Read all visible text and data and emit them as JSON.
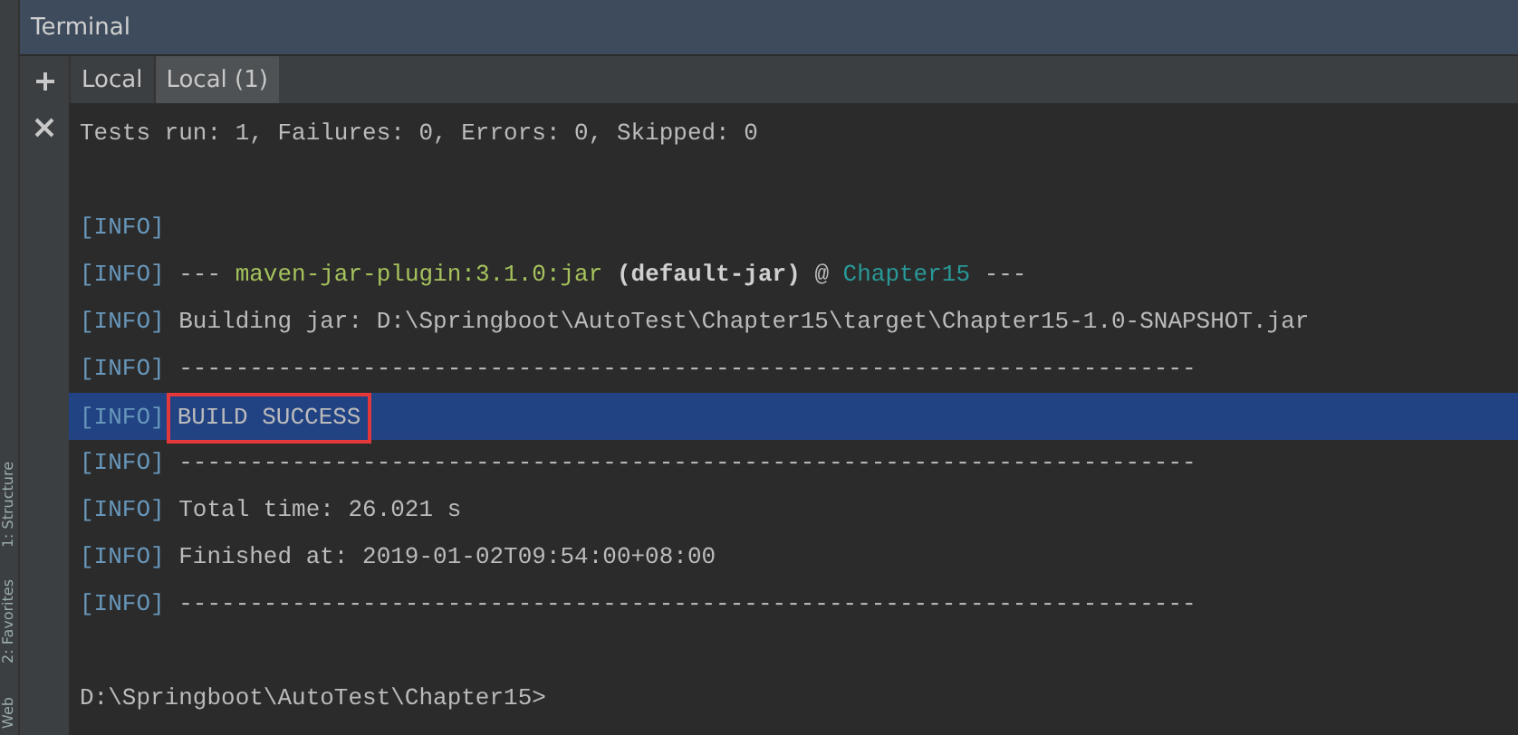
{
  "window": {
    "title": "Terminal"
  },
  "side_strip": [
    "1: Structure",
    "2: Favorites",
    "Web"
  ],
  "tabs": [
    {
      "label": "Local",
      "selected": false
    },
    {
      "label": "Local (1)",
      "selected": true
    }
  ],
  "lines": [
    {
      "selected": false,
      "segments": [
        {
          "kind": "text",
          "text": "Tests run: 1, Failures: 0, Errors: 0, Skipped: 0"
        }
      ]
    },
    {
      "selected": false
    },
    {
      "selected": false,
      "segments": [
        {
          "kind": "tag",
          "text": "[INFO]"
        }
      ]
    },
    {
      "selected": false,
      "segments": [
        {
          "kind": "tag",
          "text": "[INFO]"
        },
        {
          "kind": "text",
          "text": " --- "
        },
        {
          "kind": "plugin",
          "text": "maven-jar-plugin:3.1.0:jar"
        },
        {
          "kind": "goal",
          "text": " (default-jar)"
        },
        {
          "kind": "text",
          "text": " @ "
        },
        {
          "kind": "project",
          "text": "Chapter15"
        },
        {
          "kind": "text",
          "text": " ---"
        }
      ]
    },
    {
      "selected": false,
      "segments": [
        {
          "kind": "tag",
          "text": "[INFO]"
        },
        {
          "kind": "text",
          "text": " Building jar: D:\\Springboot\\AutoTest\\Chapter15\\target\\Chapter15-1.0-SNAPSHOT.jar"
        }
      ]
    },
    {
      "selected": false,
      "segments": [
        {
          "kind": "tag",
          "text": "[INFO]"
        },
        {
          "kind": "text",
          "text": " ------------------------------------------------------------------------"
        }
      ]
    },
    {
      "selected": true,
      "segments": [
        {
          "kind": "tag",
          "text": "[INFO]"
        },
        {
          "kind": "outlined",
          "text": "BUILD SUCCESS"
        }
      ]
    },
    {
      "selected": false,
      "segments": [
        {
          "kind": "tag",
          "text": "[INFO]"
        },
        {
          "kind": "text",
          "text": " ------------------------------------------------------------------------"
        }
      ]
    },
    {
      "selected": false,
      "segments": [
        {
          "kind": "tag",
          "text": "[INFO]"
        },
        {
          "kind": "text",
          "text": " Total time: 26.021 s"
        }
      ]
    },
    {
      "selected": false,
      "segments": [
        {
          "kind": "tag",
          "text": "[INFO]"
        },
        {
          "kind": "text",
          "text": " Finished at: 2019-01-02T09:54:00+08:00"
        }
      ]
    },
    {
      "selected": false,
      "segments": [
        {
          "kind": "tag",
          "text": "[INFO]"
        },
        {
          "kind": "text",
          "text": " ------------------------------------------------------------------------"
        }
      ]
    },
    {
      "selected": false
    },
    {
      "selected": false,
      "segments": [
        {
          "kind": "prompt",
          "text": "D:\\Springboot\\AutoTest\\Chapter15>"
        }
      ]
    }
  ]
}
